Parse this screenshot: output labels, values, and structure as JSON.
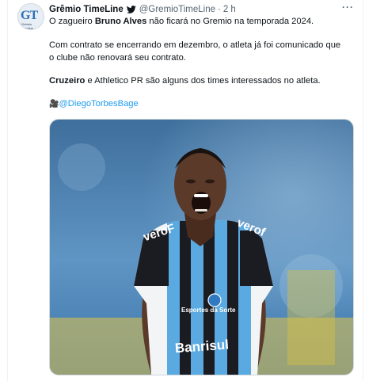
{
  "tweet": {
    "author_name": "Grêmio TimeLine",
    "handle": "@GremioTimeLine",
    "separator": "·",
    "time": "2 h",
    "more_label": "···",
    "avatar_mark": "GT",
    "avatar_sub": "Grêmio Timeline",
    "lines": {
      "l1_a": "O zagueiro ",
      "l1_b": "Bruno Alves",
      "l1_c": " não ficará no Gremio na temporada 2024.",
      "l2": " Com contrato se encerrando em dezembro, o atleta já foi comunicado que",
      "l3": "o clube não renovará seu contrato.",
      "l4_a": "Cruzeiro",
      "l4_b": " e Athletico PR são alguns dos times interessados no atleta.",
      "l5_icon": "🎥",
      "l5_link": "@DiegoTorbesBage"
    },
    "media": {
      "alt": "Photo of Grêmio player celebrating",
      "shirt_sponsor": "veroF",
      "shirt_sponsor_right": "verof",
      "shirt_brand": "Banrisul",
      "shirt_badge": "Esportes da Sorte",
      "colors": {
        "stripe_blue": "#5aa9e0",
        "stripe_dark": "#1b1b22",
        "shirt_white": "#f2f4f6",
        "background": "#4f86b8"
      }
    },
    "icons": {
      "verified": "bird-icon",
      "more": "more-icon",
      "camera": "camera-icon"
    }
  }
}
